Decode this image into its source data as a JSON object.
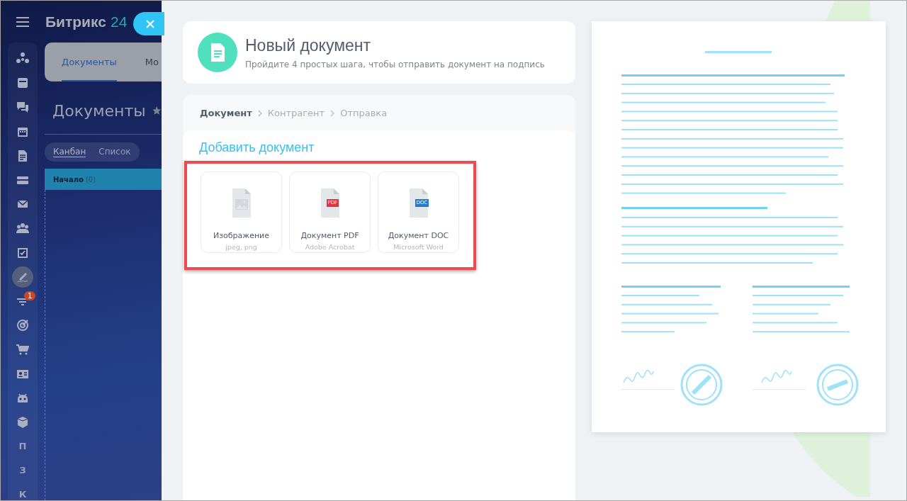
{
  "background_page": {
    "logo": {
      "name": "Битрикс",
      "suffix": "24"
    },
    "sidebar": {
      "items": [
        {
          "kind": "icon",
          "selected": false
        },
        {
          "kind": "icon",
          "selected": false
        },
        {
          "kind": "icon",
          "selected": false
        },
        {
          "kind": "icon",
          "selected": false
        },
        {
          "kind": "icon",
          "selected": false
        },
        {
          "kind": "icon",
          "selected": false
        },
        {
          "kind": "icon",
          "selected": false
        },
        {
          "kind": "icon",
          "selected": false
        },
        {
          "kind": "icon",
          "selected": false
        },
        {
          "kind": "icon",
          "selected": true
        },
        {
          "kind": "icon",
          "selected": false,
          "badge": "1"
        },
        {
          "kind": "icon",
          "selected": false
        },
        {
          "kind": "icon",
          "selected": false
        },
        {
          "kind": "icon",
          "selected": false
        },
        {
          "kind": "icon",
          "selected": false
        },
        {
          "kind": "icon",
          "selected": false
        },
        {
          "kind": "letter",
          "label": "П",
          "selected": false
        },
        {
          "kind": "letter",
          "label": "З",
          "selected": false
        },
        {
          "kind": "letter",
          "label": "К",
          "selected": false
        }
      ]
    },
    "tabs": [
      {
        "label": "Документы",
        "selected": true
      },
      {
        "label": "Мо",
        "selected": false
      }
    ],
    "title": "Документы",
    "view_switch": [
      {
        "label": "Канбан",
        "selected": true
      },
      {
        "label": "Список",
        "selected": false
      }
    ],
    "kanban_column": {
      "title": "Начало",
      "count": "(0)"
    }
  },
  "slider": {
    "header": {
      "title": "Новый документ",
      "subtitle": "Пройдите 4 простых шага, чтобы отправить документ на подпись"
    },
    "steps": [
      {
        "label": "Документ",
        "selected": true
      },
      {
        "label": "Контрагент",
        "selected": false
      },
      {
        "label": "Отправка",
        "selected": false
      }
    ],
    "section_title": "Добавить документ",
    "highlighted": true,
    "file_types": [
      {
        "kind": "image",
        "title": "Изображение",
        "subtitle": "jpeg, png"
      },
      {
        "kind": "pdf",
        "title": "Документ PDF",
        "subtitle": "Adobe Acrobat",
        "tag": "PDF",
        "color": "#e2343f"
      },
      {
        "kind": "doc",
        "title": "Документ DOC",
        "subtitle": "Microsoft Word",
        "tag": "DOC",
        "color": "#2b79c2"
      }
    ]
  }
}
